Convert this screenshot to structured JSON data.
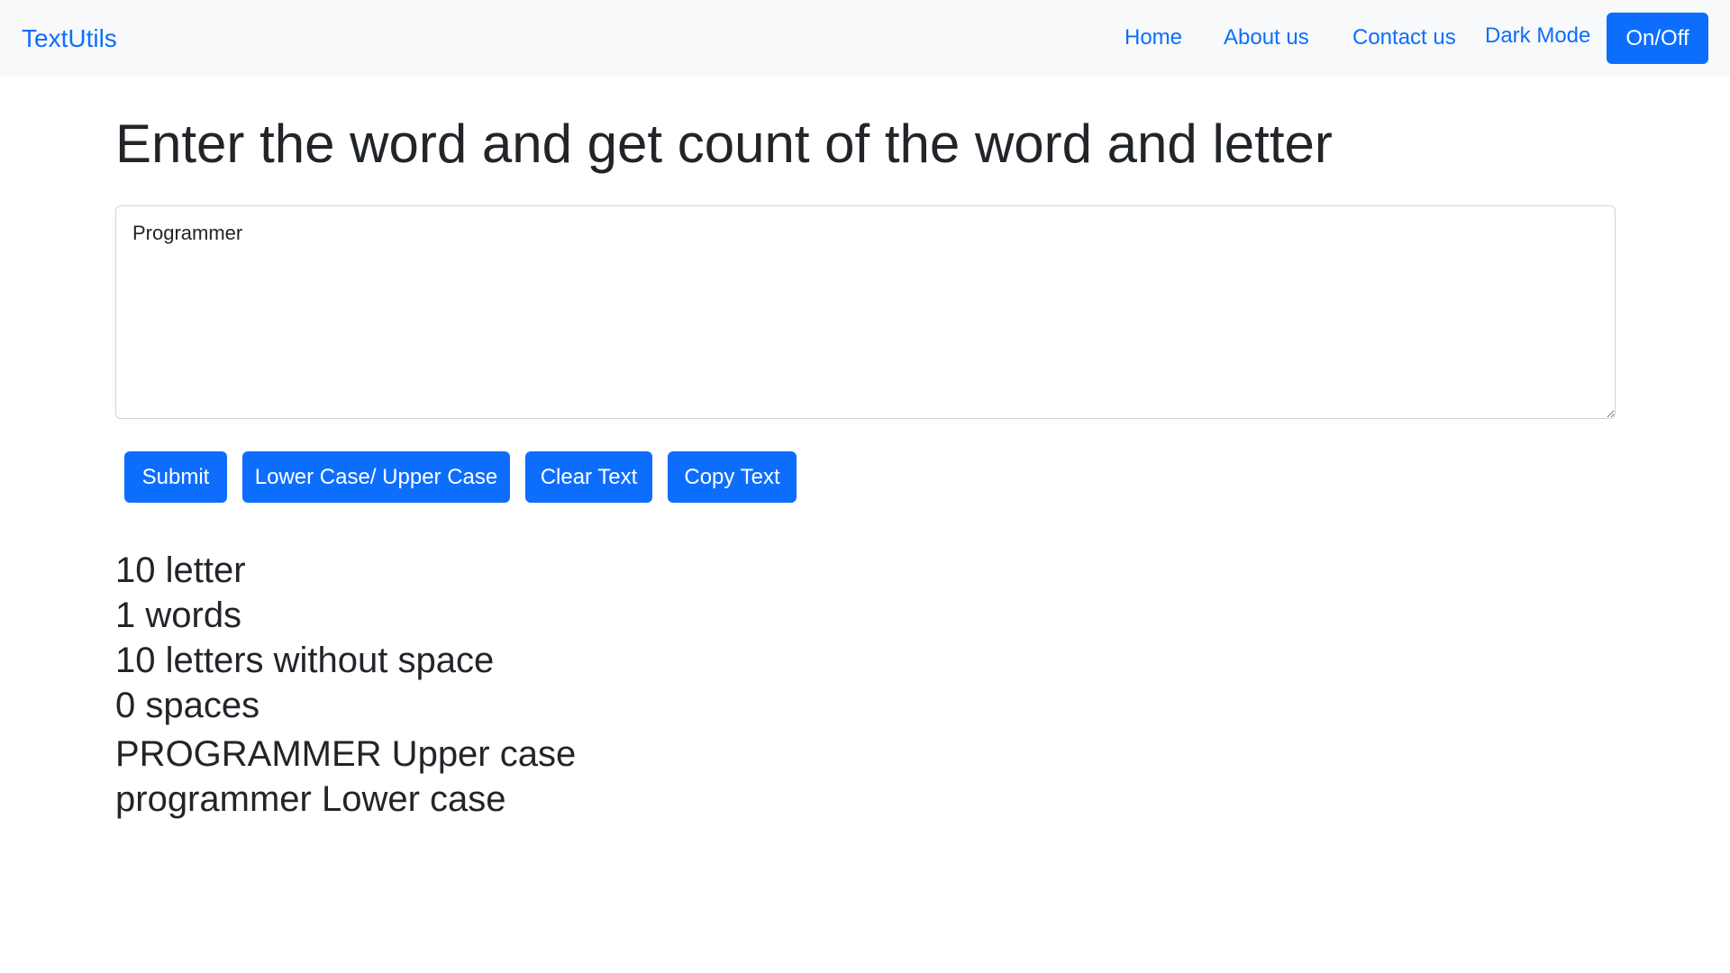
{
  "navbar": {
    "brand": "TextUtils",
    "links": {
      "home": "Home",
      "about": "About us",
      "contact": "Contact us",
      "dark_mode": "Dark Mode"
    },
    "toggle_label": "On/Off"
  },
  "main": {
    "title": "Enter the word and get count of the word and letter",
    "textarea_value": "Programmer",
    "buttons": {
      "submit": "Submit",
      "case": "Lower Case/ Upper Case",
      "clear": "Clear Text",
      "copy": "Copy Text"
    },
    "summary": {
      "letters": "10 letter",
      "words": "1 words",
      "letters_no_space": "10 letters without space",
      "spaces": "0 spaces",
      "upper": "PROGRAMMER Upper case",
      "lower": "programmer Lower case"
    }
  },
  "colors": {
    "primary": "#0d6efd",
    "navbar_bg": "#f8f9fa",
    "text": "#212529"
  }
}
